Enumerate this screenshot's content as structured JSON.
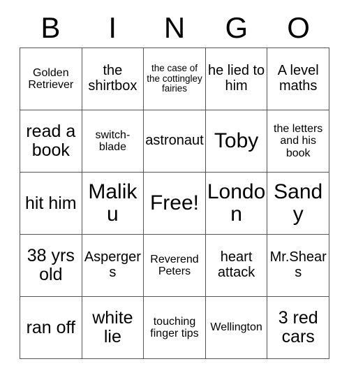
{
  "card": {
    "title_letters": [
      "B",
      "I",
      "N",
      "G",
      "O"
    ],
    "free_space_label": "Free!",
    "grid_line_color": "#555555",
    "text_color": "#000000",
    "background_color": "#ffffff",
    "columns": 5,
    "rows": 5,
    "cells": [
      {
        "text": "Golden Retriever",
        "column": "B",
        "row": 1
      },
      {
        "text": "the shirtbox",
        "column": "I",
        "row": 1
      },
      {
        "text": "the case of the cottingley fairies",
        "column": "N",
        "row": 1
      },
      {
        "text": "he lied to him",
        "column": "G",
        "row": 1
      },
      {
        "text": "A level maths",
        "column": "O",
        "row": 1
      },
      {
        "text": "read a book",
        "column": "B",
        "row": 2
      },
      {
        "text": "switch-blade",
        "column": "I",
        "row": 2
      },
      {
        "text": "astronaut",
        "column": "N",
        "row": 2
      },
      {
        "text": "Toby",
        "column": "G",
        "row": 2
      },
      {
        "text": "the letters and his book",
        "column": "O",
        "row": 2
      },
      {
        "text": "hit him",
        "column": "B",
        "row": 3
      },
      {
        "text": "Maliku",
        "column": "I",
        "row": 3
      },
      {
        "text": "Free!",
        "column": "N",
        "row": 3
      },
      {
        "text": "London",
        "column": "G",
        "row": 3
      },
      {
        "text": "Sandy",
        "column": "O",
        "row": 3
      },
      {
        "text": "38 yrs old",
        "column": "B",
        "row": 4
      },
      {
        "text": "Aspergers",
        "column": "I",
        "row": 4
      },
      {
        "text": "Reverend Peters",
        "column": "N",
        "row": 4
      },
      {
        "text": "heart attack",
        "column": "G",
        "row": 4
      },
      {
        "text": "Mr.Shears",
        "column": "O",
        "row": 4
      },
      {
        "text": "ran off",
        "column": "B",
        "row": 5
      },
      {
        "text": "white lie",
        "column": "I",
        "row": 5
      },
      {
        "text": "touching finger tips",
        "column": "N",
        "row": 5
      },
      {
        "text": "Wellington",
        "column": "G",
        "row": 5
      },
      {
        "text": "3 red cars",
        "column": "O",
        "row": 5
      }
    ]
  }
}
